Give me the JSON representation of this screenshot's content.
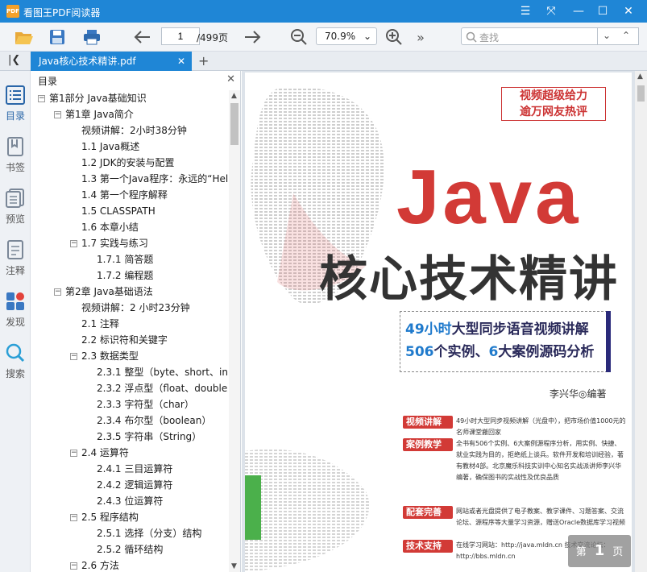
{
  "app": {
    "title": "看图王PDF阅读器",
    "logo_text": "PDF"
  },
  "toolbar": {
    "current_page": "1",
    "total_pages": "/499页",
    "zoom": "70.9%",
    "search_placeholder": "查找",
    "more": "»"
  },
  "tab": {
    "label": "Java核心技术精讲.pdf",
    "add": "+"
  },
  "rail": [
    {
      "label": "目录",
      "icon": "toc-icon"
    },
    {
      "label": "书签",
      "icon": "bookmark-icon"
    },
    {
      "label": "预览",
      "icon": "preview-icon"
    },
    {
      "label": "注释",
      "icon": "annotation-icon"
    },
    {
      "label": "发现",
      "icon": "discover-icon"
    },
    {
      "label": "搜索",
      "icon": "search-icon"
    }
  ],
  "sidebar": {
    "header": "目录"
  },
  "toc": [
    {
      "label": "第1部分 Java基础知识",
      "level": 0,
      "toggle": "−"
    },
    {
      "label": "第1章 Java简介",
      "level": 1,
      "toggle": "−"
    },
    {
      "label": "视频讲解：2小时38分钟",
      "level": 2
    },
    {
      "label": "1.1 Java概述",
      "level": 2
    },
    {
      "label": "1.2 JDK的安装与配置",
      "level": 2
    },
    {
      "label": "1.3 第一个Java程序：永远的“Hel",
      "level": 2
    },
    {
      "label": "1.4 第一个程序解释",
      "level": 2
    },
    {
      "label": "1.5 CLASSPATH",
      "level": 2
    },
    {
      "label": "1.6 本章小结",
      "level": 2
    },
    {
      "label": "1.7 实践与练习",
      "level": 2,
      "toggle": "−"
    },
    {
      "label": "1.7.1 简答题",
      "level": 3
    },
    {
      "label": "1.7.2 编程题",
      "level": 3
    },
    {
      "label": "第2章 Java基础语法",
      "level": 1,
      "toggle": "−"
    },
    {
      "label": "视频讲解：2 小时23分钟",
      "level": 2
    },
    {
      "label": "2.1 注释",
      "level": 2
    },
    {
      "label": "2.2 标识符和关键字",
      "level": 2
    },
    {
      "label": "2.3 数据类型",
      "level": 2,
      "toggle": "−"
    },
    {
      "label": "2.3.1 整型（byte、short、int.",
      "level": 3
    },
    {
      "label": "2.3.2 浮点型（float、double）",
      "level": 3
    },
    {
      "label": "2.3.3 字符型（char）",
      "level": 3
    },
    {
      "label": "2.3.4 布尔型（boolean）",
      "level": 3
    },
    {
      "label": "2.3.5 字符串（String）",
      "level": 3
    },
    {
      "label": "2.4 运算符",
      "level": 2,
      "toggle": "−"
    },
    {
      "label": "2.4.1 三目运算符",
      "level": 3
    },
    {
      "label": "2.4.2 逻辑运算符",
      "level": 3
    },
    {
      "label": "2.4.3 位运算符",
      "level": 3
    },
    {
      "label": "2.5 程序结构",
      "level": 2,
      "toggle": "−"
    },
    {
      "label": "2.5.1 选择（分支）结构",
      "level": 3
    },
    {
      "label": "2.5.2 循环结构",
      "level": 3
    },
    {
      "label": "2.6 方法",
      "level": 2,
      "toggle": "−"
    }
  ],
  "cover": {
    "slogan_line1": "视频超级给力",
    "slogan_line2": "逾万网友热评",
    "title_latin": "Java",
    "title_cn": "核心技术精讲",
    "feature1_num1": "49",
    "feature1_mid": "小时",
    "feature1_rest": "大型同步语音视频讲解",
    "feature2_num1": "506",
    "feature2_mid": "个实例、",
    "feature2_num2": "6",
    "feature2_mid2": "大",
    "feature2_rest": "案例源码分析",
    "author": "李兴华◎编著",
    "blocks": [
      {
        "tag": "视频讲解",
        "text": "49小时大型同步视频讲解（光盘中），把市场价值1000元的名师课堂搬回家"
      },
      {
        "tag": "案例教学",
        "text": "全书有506个实例、6大案例源程序分析，用实例、快捷、就业实践为目的，拒绝纸上谈兵。软件开发和培训经验，著有教材4部。北京魔乐科技实训中心知名实战派讲师李兴华编著，确保图书的实战性及优良品质"
      },
      {
        "tag": "配套完善",
        "text": "网站或者光盘提供了电子教案、教学课件、习题答案、交流论坛、源程序等大量学习资源，赠送Oracle数据库学习视频"
      },
      {
        "tag": "技术支持",
        "text": "在线学习网站：http://java.mldn.cn  技术交流论坛：http://bbs.mldn.cn"
      }
    ]
  },
  "page_badge": {
    "prefix": "第",
    "num": "1",
    "suffix": "页"
  },
  "colors": {
    "titlebar": "#1f86d6",
    "accent_red": "#d23a36",
    "tab": "#1f86d6"
  }
}
